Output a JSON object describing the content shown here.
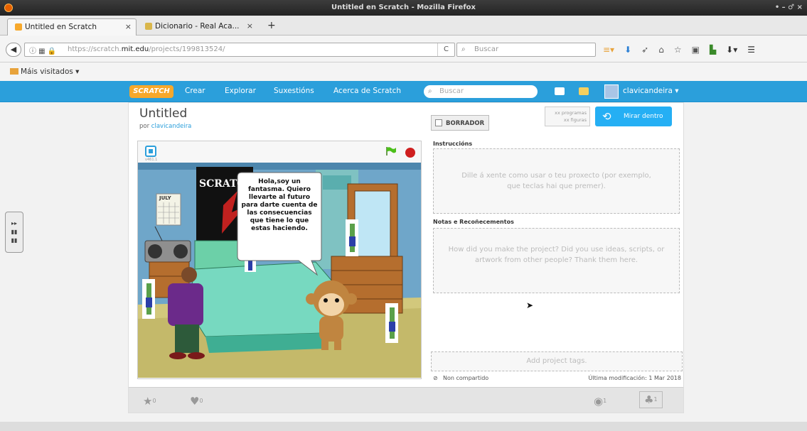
{
  "window": {
    "title": "Untitled en Scratch - Mozilla Firefox",
    "controls": "• – ♂ ×"
  },
  "tabs": [
    {
      "label": "Untitled en Scratch",
      "close": "×"
    },
    {
      "label": "Dicionario - Real Aca...",
      "close": "×"
    }
  ],
  "new_tab": "+",
  "address": {
    "prefix": "https://scratch.",
    "host": "mit.edu",
    "path": "/projects/199813524/",
    "reload": "C"
  },
  "browser_search": {
    "placeholder": "Buscar"
  },
  "bookmarks": {
    "most_visited": "Máis visitados ▾"
  },
  "scratch_header": {
    "logo": "SCRATCH",
    "nav": [
      "Crear",
      "Explorar",
      "Suxestións",
      "Acerca de Scratch"
    ],
    "search_placeholder": "Buscar",
    "username": "clavicandeira ▾"
  },
  "project": {
    "title": "Untitled",
    "by_prefix": "por",
    "author": "clavicandeira",
    "draft_label": "BORRADOR",
    "stats_line1": "xx programas",
    "stats_line2": "xx figuras",
    "see_inside": "Mirar dentro"
  },
  "stage": {
    "version": "v461.1",
    "speech": "Hola,soy un fantasma. Quiero llevarte al futuro para darte cuenta de las consecuencias que tiene lo que estas haciendo.",
    "poster_text": "SCRATCH",
    "calendar": "JULY"
  },
  "instructions": {
    "heading": "Instruccións",
    "placeholder": "Dille á xente como usar o teu proxecto (por exemplo, que teclas hai que premer)."
  },
  "notes": {
    "heading": "Notas e Recoñecementos",
    "placeholder": "How did you make the project? Did you use ideas, scripts, or artwork from other people? Thank them here."
  },
  "tags": {
    "placeholder": "Add project tags."
  },
  "sharing": {
    "status": "Non compartido",
    "modified": "Última modificación: 1 Mar 2018"
  },
  "counts": {
    "favorites": "0",
    "loves": "0",
    "views": "1",
    "remixes": "1"
  }
}
